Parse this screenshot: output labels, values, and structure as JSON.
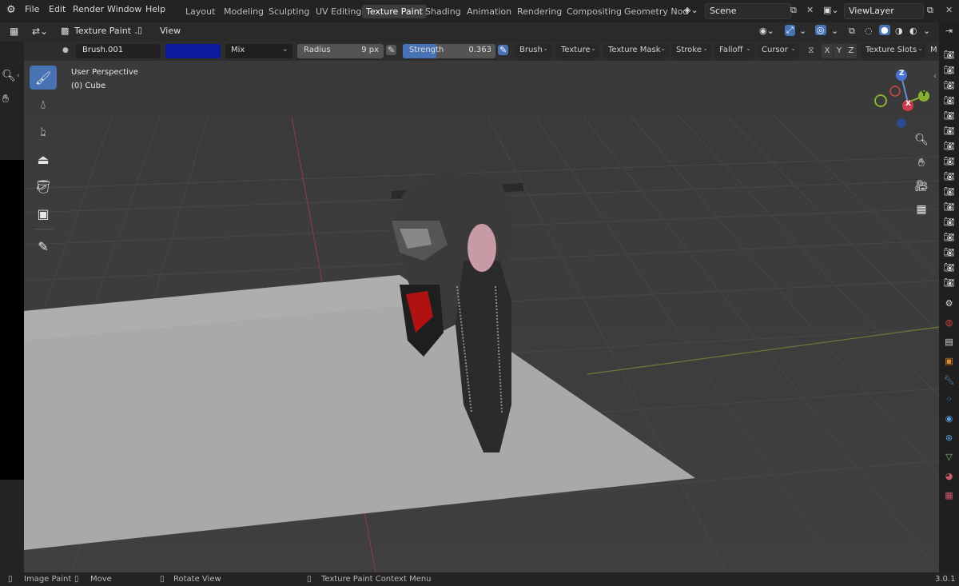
{
  "menu": {
    "items": [
      "File",
      "Edit",
      "Render",
      "Window",
      "Help"
    ]
  },
  "workspaces": {
    "tabs": [
      "Layout",
      "Modeling",
      "Sculpting",
      "UV Editing",
      "Texture Paint",
      "Shading",
      "Animation",
      "Rendering",
      "Compositing",
      "Geometry Nod"
    ],
    "active": "Texture Paint"
  },
  "scene": {
    "label": "Scene"
  },
  "view_layer": {
    "label": "ViewLayer"
  },
  "header": {
    "mode": "Texture Paint",
    "view": "View"
  },
  "tool_settings": {
    "brush_name": "Brush.001",
    "color": "#0c1a9e",
    "blend": "Mix",
    "radius_label": "Radius",
    "radius_value": "9 px",
    "strength_label": "Strength",
    "strength_value": "0.363",
    "menus": [
      "Brush",
      "Texture",
      "Texture Mask",
      "Stroke",
      "Falloff",
      "Cursor"
    ],
    "axes": [
      "X",
      "Y",
      "Z"
    ],
    "texture_slots": "Texture Slots",
    "overflow": "M"
  },
  "viewport": {
    "perspective": "User Perspective",
    "object": "(0) Cube"
  },
  "gizmo": {
    "z": "Z",
    "y": "Y",
    "x": "X"
  },
  "status": {
    "left_action": "Image Paint",
    "middle_action": "Move",
    "rotate_action": "Rotate View",
    "context_action": "Texture Paint Context Menu",
    "version": "3.0.1"
  },
  "colors": {
    "accent": "#4772b3",
    "brush_color": "#0c1a9e"
  }
}
